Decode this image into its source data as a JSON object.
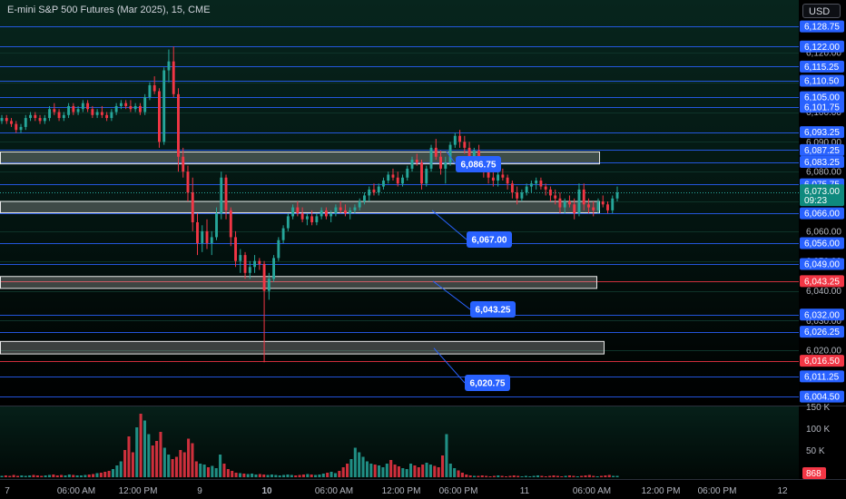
{
  "header": {
    "title": "E-mini S&P 500 Futures (Mar 2025), 15, CME",
    "currency": "USD"
  },
  "colors": {
    "up": "#26a69a",
    "down": "#f23645",
    "level_line": "#2962ff",
    "tag_blue": "#2962ff",
    "tag_red": "#f23645",
    "last_price_tag": "#0f8a7e",
    "zone_fill": "#c7c7c7"
  },
  "chart_data": {
    "type": "candlestick",
    "price_axis": {
      "range": [
        6003,
        6130
      ],
      "ticks": [
        "6,120.00",
        "6,110.00",
        "6,100.00",
        "6,090.00",
        "6,080.00",
        "6,070.00",
        "6,060.00",
        "6,050.00",
        "6,040.00",
        "6,030.00",
        "6,020.00"
      ]
    },
    "time_axis": {
      "labels": [
        "7",
        "06:00 AM",
        "12:00 PM",
        "9",
        "10",
        "06:00 AM",
        "12:00 PM",
        "06:00 PM",
        "11",
        "06:00 AM",
        "12:00 PM",
        "06:00 PM",
        "12"
      ],
      "bold": [
        false,
        false,
        false,
        false,
        true,
        false,
        false,
        false,
        false,
        false,
        false,
        false,
        false
      ]
    },
    "levels": [
      "6,128.75",
      "6,122.00",
      "6,115.25",
      "6,110.50",
      "6,105.00",
      "6,101.75",
      "6,093.25",
      "6,087.25",
      "6,083.25",
      "6,075.75",
      "6,066.00",
      "6,056.00",
      "6,049.00",
      "6,043.25",
      "6,032.00",
      "6,026.25",
      "6,016.50",
      "6,011.25",
      "6,004.50"
    ],
    "level_values": [
      6128.75,
      6122,
      6115.25,
      6110.5,
      6105,
      6101.75,
      6093.25,
      6087.25,
      6083.25,
      6075.75,
      6066,
      6056,
      6049,
      6043.25,
      6032,
      6026.25,
      6016.5,
      6011.25,
      6004.5
    ],
    "red_levels": [
      "6,043.25",
      "6,016.50"
    ],
    "last_price": {
      "value": "6,073.00",
      "countdown": "09:23"
    },
    "zones": [
      {
        "top": 6086.6,
        "bottom": 6082.6
      },
      {
        "top": 6070.0,
        "bottom": 6066.2
      },
      {
        "top": 6044.8,
        "bottom": 6040.8
      },
      {
        "top": 6023.0,
        "bottom": 6018.8
      }
    ],
    "callouts": [
      {
        "label": "6,086.75",
        "value": 6086.75
      },
      {
        "label": "6,067.00",
        "value": 6067.0
      },
      {
        "label": "6,043.25",
        "value": 6043.25
      },
      {
        "label": "6,020.75",
        "value": 6020.75
      }
    ],
    "volume_axis": {
      "ticks": [
        "150 K",
        "100 K",
        "50 K"
      ],
      "current": "868"
    },
    "candles": [
      [
        6097,
        6099,
        6096,
        6098
      ],
      [
        6098,
        6099,
        6096,
        6097
      ],
      [
        6097,
        6098,
        6095,
        6096
      ],
      [
        6096,
        6097,
        6093,
        6094
      ],
      [
        6094,
        6096,
        6093,
        6095
      ],
      [
        6095,
        6099,
        6094,
        6098
      ],
      [
        6098,
        6100,
        6097,
        6099
      ],
      [
        6099,
        6100,
        6097,
        6098
      ],
      [
        6098,
        6099,
        6096,
        6097
      ],
      [
        6097,
        6099,
        6096,
        6098
      ],
      [
        6098,
        6102,
        6097,
        6101
      ],
      [
        6101,
        6103,
        6099,
        6100
      ],
      [
        6100,
        6101,
        6097,
        6098
      ],
      [
        6098,
        6100,
        6097,
        6099
      ],
      [
        6099,
        6103,
        6098,
        6102
      ],
      [
        6102,
        6103,
        6099,
        6100
      ],
      [
        6100,
        6102,
        6099,
        6101
      ],
      [
        6101,
        6104,
        6100,
        6103
      ],
      [
        6103,
        6104,
        6100,
        6101
      ],
      [
        6101,
        6102,
        6098,
        6099
      ],
      [
        6099,
        6101,
        6098,
        6100
      ],
      [
        6100,
        6102,
        6098,
        6099
      ],
      [
        6099,
        6100,
        6097,
        6098
      ],
      [
        6098,
        6101,
        6097,
        6100
      ],
      [
        6100,
        6103,
        6099,
        6102
      ],
      [
        6102,
        6104,
        6101,
        6103
      ],
      [
        6103,
        6104,
        6101,
        6102
      ],
      [
        6102,
        6104,
        6100,
        6101
      ],
      [
        6101,
        6103,
        6100,
        6102
      ],
      [
        6102,
        6103,
        6099,
        6100
      ],
      [
        6100,
        6106,
        6099,
        6105
      ],
      [
        6105,
        6110,
        6104,
        6109
      ],
      [
        6109,
        6112,
        6106,
        6107
      ],
      [
        6107,
        6108,
        6088,
        6090
      ],
      [
        6090,
        6115,
        6089,
        6114
      ],
      [
        6114,
        6121,
        6110,
        6117
      ],
      [
        6117,
        6122,
        6105,
        6106
      ],
      [
        6106,
        6108,
        6080,
        6085
      ],
      [
        6085,
        6088,
        6078,
        6080
      ],
      [
        6080,
        6082,
        6070,
        6073
      ],
      [
        6073,
        6078,
        6060,
        6063
      ],
      [
        6063,
        6066,
        6052,
        6056
      ],
      [
        6056,
        6062,
        6053,
        6060
      ],
      [
        6060,
        6064,
        6054,
        6056
      ],
      [
        6056,
        6060,
        6052,
        6058
      ],
      [
        6058,
        6068,
        6057,
        6066
      ],
      [
        6066,
        6080,
        6064,
        6078
      ],
      [
        6078,
        6079,
        6064,
        6067
      ],
      [
        6067,
        6068,
        6055,
        6058
      ],
      [
        6058,
        6060,
        6048,
        6050
      ],
      [
        6050,
        6054,
        6046,
        6052
      ],
      [
        6052,
        6053,
        6044,
        6046
      ],
      [
        6046,
        6050,
        6044,
        6048
      ],
      [
        6048,
        6052,
        6046,
        6050
      ],
      [
        6050,
        6051,
        6047,
        6049
      ],
      [
        6049,
        6050,
        6016,
        6040
      ],
      [
        6040,
        6046,
        6037,
        6044
      ],
      [
        6044,
        6052,
        6043,
        6051
      ],
      [
        6051,
        6058,
        6050,
        6057
      ],
      [
        6057,
        6062,
        6056,
        6061
      ],
      [
        6061,
        6066,
        6060,
        6065
      ],
      [
        6065,
        6069,
        6064,
        6068
      ],
      [
        6068,
        6070,
        6065,
        6066
      ],
      [
        6066,
        6068,
        6063,
        6064
      ],
      [
        6064,
        6066,
        6062,
        6065
      ],
      [
        6065,
        6067,
        6062,
        6063
      ],
      [
        6063,
        6066,
        6062,
        6065
      ],
      [
        6065,
        6068,
        6064,
        6067
      ],
      [
        6067,
        6068,
        6064,
        6065
      ],
      [
        6065,
        6067,
        6063,
        6066
      ],
      [
        6066,
        6069,
        6065,
        6068
      ],
      [
        6068,
        6070,
        6066,
        6067
      ],
      [
        6067,
        6069,
        6065,
        6066
      ],
      [
        6066,
        6068,
        6064,
        6067
      ],
      [
        6067,
        6069,
        6066,
        6068
      ],
      [
        6068,
        6071,
        6067,
        6070
      ],
      [
        6070,
        6073,
        6069,
        6072
      ],
      [
        6072,
        6075,
        6070,
        6074
      ],
      [
        6074,
        6076,
        6072,
        6073
      ],
      [
        6073,
        6076,
        6072,
        6075
      ],
      [
        6075,
        6078,
        6074,
        6077
      ],
      [
        6077,
        6080,
        6076,
        6079
      ],
      [
        6079,
        6081,
        6077,
        6078
      ],
      [
        6078,
        6080,
        6075,
        6076
      ],
      [
        6076,
        6079,
        6075,
        6078
      ],
      [
        6078,
        6082,
        6077,
        6081
      ],
      [
        6081,
        6085,
        6080,
        6084
      ],
      [
        6084,
        6086,
        6082,
        6083
      ],
      [
        6083,
        6084,
        6074,
        6076
      ],
      [
        6076,
        6082,
        6075,
        6081
      ],
      [
        6081,
        6089,
        6080,
        6088
      ],
      [
        6088,
        6091,
        6084,
        6085
      ],
      [
        6085,
        6087,
        6079,
        6081
      ],
      [
        6081,
        6085,
        6076,
        6083
      ],
      [
        6083,
        6090,
        6082,
        6089
      ],
      [
        6089,
        6093,
        6088,
        6092
      ],
      [
        6092,
        6094,
        6088,
        6090
      ],
      [
        6090,
        6092,
        6086,
        6088
      ],
      [
        6088,
        6090,
        6083,
        6085
      ],
      [
        6085,
        6088,
        6082,
        6087
      ],
      [
        6087,
        6089,
        6083,
        6084
      ],
      [
        6084,
        6085,
        6078,
        6080
      ],
      [
        6080,
        6082,
        6076,
        6078
      ],
      [
        6078,
        6080,
        6075,
        6077
      ],
      [
        6077,
        6080,
        6075,
        6079
      ],
      [
        6079,
        6081,
        6077,
        6078
      ],
      [
        6078,
        6079,
        6074,
        6076
      ],
      [
        6076,
        6077,
        6071,
        6073
      ],
      [
        6073,
        6075,
        6069,
        6071
      ],
      [
        6071,
        6074,
        6070,
        6073
      ],
      [
        6073,
        6076,
        6072,
        6075
      ],
      [
        6075,
        6077,
        6073,
        6076
      ],
      [
        6076,
        6078,
        6074,
        6077
      ],
      [
        6077,
        6078,
        6074,
        6075
      ],
      [
        6075,
        6076,
        6072,
        6074
      ],
      [
        6074,
        6075,
        6070,
        6072
      ],
      [
        6072,
        6074,
        6069,
        6071
      ],
      [
        6071,
        6073,
        6066,
        6068
      ],
      [
        6068,
        6071,
        6066,
        6070
      ],
      [
        6070,
        6072,
        6068,
        6069
      ],
      [
        6069,
        6071,
        6064,
        6066
      ],
      [
        6066,
        6076,
        6065,
        6074
      ],
      [
        6074,
        6076,
        6067,
        6069
      ],
      [
        6069,
        6071,
        6066,
        6068
      ],
      [
        6068,
        6070,
        6065,
        6067
      ],
      [
        6067,
        6071,
        6066,
        6070
      ],
      [
        6070,
        6072,
        6068,
        6069
      ],
      [
        6069,
        6070,
        6066,
        6067
      ],
      [
        6067,
        6072,
        6066,
        6071
      ],
      [
        6071,
        6075,
        6070,
        6073
      ]
    ],
    "volume": [
      3,
      4,
      3,
      5,
      3,
      4,
      3,
      4,
      5,
      4,
      3,
      4,
      5,
      6,
      4,
      5,
      4,
      6,
      5,
      4,
      4,
      5,
      6,
      7,
      9,
      10,
      12,
      14,
      18,
      26,
      35,
      60,
      90,
      55,
      110,
      140,
      125,
      95,
      70,
      80,
      100,
      65,
      50,
      40,
      45,
      60,
      55,
      85,
      75,
      35,
      30,
      28,
      22,
      25,
      20,
      50,
      30,
      18,
      14,
      10,
      9,
      8,
      7,
      8,
      6,
      7,
      6,
      5,
      6,
      5,
      4,
      5,
      6,
      5,
      4,
      5,
      6,
      7,
      6,
      5,
      6,
      8,
      10,
      12,
      9,
      14,
      22,
      30,
      40,
      65,
      55,
      45,
      35,
      30,
      28,
      26,
      22,
      30,
      38,
      28,
      24,
      20,
      18,
      30,
      26,
      22,
      28,
      32,
      28,
      25,
      22,
      48,
      95,
      30,
      20,
      15,
      10,
      6,
      4,
      3,
      3,
      4,
      3,
      2,
      3,
      4,
      3,
      2,
      3,
      4,
      3,
      2,
      3,
      2,
      3,
      4,
      3,
      2,
      3,
      4,
      3,
      2,
      3,
      4,
      3,
      2,
      3,
      4,
      5,
      3,
      2,
      3,
      4,
      5,
      3,
      3
    ]
  }
}
